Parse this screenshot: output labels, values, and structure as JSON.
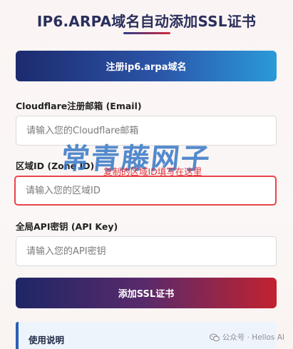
{
  "header": {
    "title": "IP6.ARPA域名自动添加SSL证书"
  },
  "register_button": {
    "label": "注册ip6.arpa域名"
  },
  "form": {
    "email": {
      "label": "Cloudflare注册邮箱 (Email)",
      "placeholder": "请输入您的Cloudflare邮箱",
      "value": ""
    },
    "zone_id": {
      "label": "区域ID (Zone ID)",
      "placeholder": "请输入您的区域ID",
      "value": ""
    },
    "api_key": {
      "label": "全局API密钥 (API Key)",
      "placeholder": "请输入您的API密钥",
      "value": ""
    }
  },
  "add_button": {
    "label": "添加SSL证书"
  },
  "overlay": {
    "watermark": "常青藤网子",
    "annotation": "复制的区域ID填写在这里"
  },
  "usage": {
    "title": "使用说明"
  },
  "footer": {
    "text": "公众号 · Hellos AI",
    "icon": "wechat-icon"
  },
  "colors": {
    "title": "#2a2f5c",
    "highlight_border": "#e8454b",
    "annotation": "#e2333b",
    "watermark": "#2f73c4",
    "usage_accent": "#2b5fb5"
  }
}
